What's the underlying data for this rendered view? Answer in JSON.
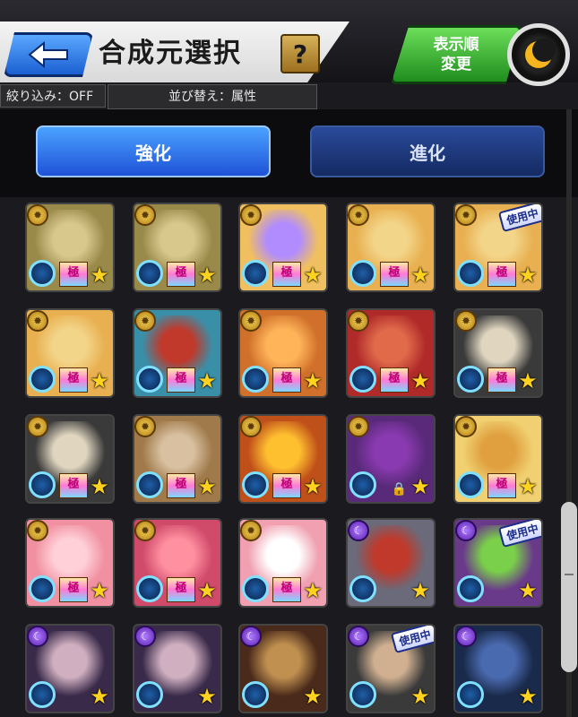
{
  "header": {
    "title": "合成元選択",
    "help_label": "?",
    "order_label_line1": "表示順",
    "order_label_line2": "変更",
    "filter_label": "絞り込み：OFF",
    "sort_label": "並び替え：属性"
  },
  "tabs": {
    "strengthen": "強化",
    "evolve": "進化"
  },
  "badges": {
    "rank": "極",
    "in_use": "使用中"
  },
  "icons": {
    "back": "back-arrow-icon",
    "moon": "moon-icon",
    "star": "★",
    "element_light": "light-element-icon",
    "element_dark": "dark-element-icon"
  },
  "colors": {
    "accent_blue": "#1f52d8",
    "accent_green": "#1e8d1e",
    "gold": "#f5d35a"
  },
  "cards": [
    {
      "element": "light",
      "rank": true,
      "in_use": false,
      "bg": "#9a8a4a",
      "fg": "#d8c88c"
    },
    {
      "element": "light",
      "rank": true,
      "in_use": false,
      "bg": "#9a8a4a",
      "fg": "#d8c88c"
    },
    {
      "element": "light",
      "rank": true,
      "in_use": false,
      "bg": "#f0c060",
      "fg": "#b08cff"
    },
    {
      "element": "light",
      "rank": true,
      "in_use": false,
      "bg": "#e8b050",
      "fg": "#f3d58a"
    },
    {
      "element": "light",
      "rank": true,
      "in_use": true,
      "bg": "#e8b050",
      "fg": "#f3d58a"
    },
    {
      "element": "light",
      "rank": true,
      "in_use": false,
      "bg": "#e8b050",
      "fg": "#f3d58a"
    },
    {
      "element": "light",
      "rank": true,
      "in_use": false,
      "bg": "#3a8fa8",
      "fg": "#c0392b"
    },
    {
      "element": "light",
      "rank": true,
      "in_use": false,
      "bg": "#d0702a",
      "fg": "#ffb45a"
    },
    {
      "element": "light",
      "rank": true,
      "in_use": false,
      "bg": "#b02a2a",
      "fg": "#e06a4a"
    },
    {
      "element": "light",
      "rank": true,
      "in_use": false,
      "bg": "#3a3a3a",
      "fg": "#e0d6c0"
    },
    {
      "element": "light",
      "rank": true,
      "in_use": false,
      "bg": "#3a3a3a",
      "fg": "#e0d6c0"
    },
    {
      "element": "light",
      "rank": true,
      "in_use": false,
      "bg": "#a07a4a",
      "fg": "#d8c0a0"
    },
    {
      "element": "light",
      "rank": true,
      "in_use": false,
      "bg": "#c0501a",
      "fg": "#ffc030"
    },
    {
      "element": "light",
      "rank": false,
      "in_use": false,
      "locked": true,
      "bg": "#5a2a7a",
      "fg": "#8a3ab0"
    },
    {
      "element": "light",
      "rank": true,
      "in_use": false,
      "bg": "#f0d070",
      "fg": "#e0a040"
    },
    {
      "element": "light",
      "rank": true,
      "in_use": false,
      "bg": "#f090a0",
      "fg": "#ffd0d8"
    },
    {
      "element": "light",
      "rank": true,
      "in_use": false,
      "bg": "#d04a6a",
      "fg": "#ff90a0"
    },
    {
      "element": "light",
      "rank": true,
      "in_use": false,
      "bg": "#f0a0b0",
      "fg": "#ffffff"
    },
    {
      "element": "dark",
      "rank": false,
      "in_use": false,
      "bg": "#6a6a7a",
      "fg": "#c0392b"
    },
    {
      "element": "dark",
      "rank": false,
      "in_use": true,
      "bg": "#6a3a8a",
      "fg": "#7ad04a"
    },
    {
      "element": "dark",
      "rank": false,
      "in_use": false,
      "bg": "#3a2a4a",
      "fg": "#d0b0c0"
    },
    {
      "element": "dark",
      "rank": false,
      "in_use": false,
      "bg": "#3a2a4a",
      "fg": "#d0b0c0"
    },
    {
      "element": "dark",
      "rank": false,
      "in_use": false,
      "bg": "#4a2a1a",
      "fg": "#c09050"
    },
    {
      "element": "dark",
      "rank": false,
      "in_use": true,
      "bg": "#3a3a3a",
      "fg": "#d0b090"
    },
    {
      "element": "dark",
      "rank": false,
      "in_use": false,
      "bg": "#1a2a4a",
      "fg": "#4a6ab0"
    }
  ]
}
